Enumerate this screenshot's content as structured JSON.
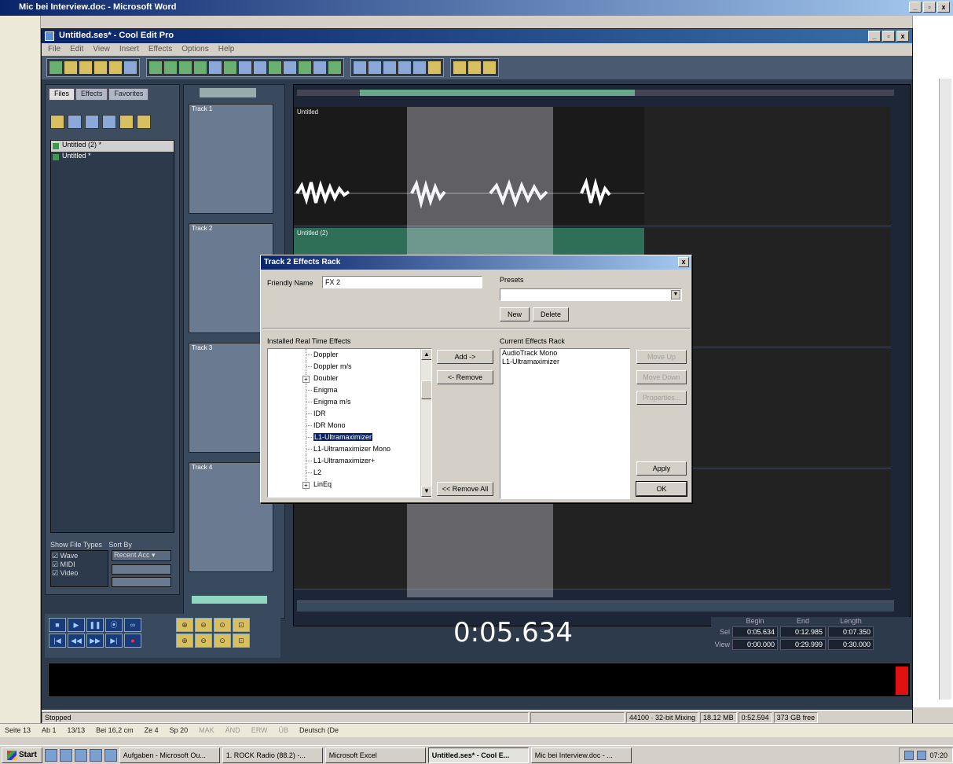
{
  "word": {
    "title": "Mic bei Interview.doc - Microsoft Word",
    "statusbar": [
      "Seite 13",
      "Ab 1",
      "13/13",
      "Bei 16,2 cm",
      "Ze 4",
      "Sp 20",
      "MAK",
      "ÄND",
      "ERW",
      "ÜB",
      "Deutsch (De"
    ]
  },
  "coolEdit": {
    "title": "Untitled.ses* - Cool Edit Pro",
    "menu": [
      "File",
      "Edit",
      "View",
      "Insert",
      "Effects",
      "Options",
      "Help"
    ],
    "panel_tabs": [
      "Files",
      "Effects",
      "Favorites"
    ],
    "files": [
      "Untitled (2) *",
      "Untitled *"
    ],
    "show_file_types": "Show File Types",
    "sort_by": "Sort By",
    "sort_value": "Recent Acc",
    "file_types": [
      "Wave",
      "MIDI",
      "Video"
    ],
    "tracks": [
      "Track 1",
      "Track 2",
      "Track 3",
      "Track 4"
    ],
    "clips": [
      "Untitled",
      "Untitled (2)"
    ],
    "time": "0:05.634",
    "selview": {
      "headers": [
        "Begin",
        "End",
        "Length"
      ],
      "sel_label": "Sel",
      "view_label": "View",
      "sel": [
        "0:05.634",
        "0:12.985",
        "0:07.350"
      ],
      "view": [
        "0:00.000",
        "0:29.999",
        "0:30.000"
      ]
    },
    "status": {
      "state": "Stopped",
      "cells": [
        "44100 · 32-bit Mixing",
        "18.12 MB",
        "0:52.594",
        "373 GB free"
      ]
    }
  },
  "dialog": {
    "title": "Track 2 Effects Rack",
    "friendly_name_label": "Friendly Name",
    "friendly_name": "FX 2",
    "presets_label": "Presets",
    "presets_value": "",
    "new": "New",
    "delete": "Delete",
    "installed_label": "Installed Real Time Effects",
    "installed": [
      {
        "name": "Doppler",
        "expander": false
      },
      {
        "name": "Doppler m/s",
        "expander": false
      },
      {
        "name": "Doubler",
        "expander": true
      },
      {
        "name": "Enigma",
        "expander": false
      },
      {
        "name": "Enigma m/s",
        "expander": false
      },
      {
        "name": "IDR",
        "expander": false
      },
      {
        "name": "IDR Mono",
        "expander": false
      },
      {
        "name": "L1-Ultramaximizer",
        "expander": false,
        "selected": true
      },
      {
        "name": "L1-Ultramaximizer Mono",
        "expander": false
      },
      {
        "name": "L1-Ultramaximizer+",
        "expander": false
      },
      {
        "name": "L2",
        "expander": false
      },
      {
        "name": "LinEq",
        "expander": true
      }
    ],
    "add": "Add ->",
    "remove": "<- Remove",
    "remove_all": "<< Remove All",
    "current_label": "Current Effects Rack",
    "current": [
      "AudioTrack Mono",
      "L1-Ultramaximizer"
    ],
    "move_up": "Move Up",
    "move_down": "Move Down",
    "properties": "Properties...",
    "apply": "Apply",
    "ok": "OK"
  },
  "taskbar": {
    "start": "Start",
    "tasks": [
      "Aufgaben - Microsoft Ou...",
      "1. ROCK Radio (88.2) -...",
      "Microsoft Excel",
      "Untitled.ses* - Cool E...",
      "Mic bei Interview.doc - ..."
    ],
    "clock": "07:20"
  },
  "colors": {
    "selection": "#0a246a",
    "peak": "#e01010",
    "waveform": "#ffffff"
  }
}
